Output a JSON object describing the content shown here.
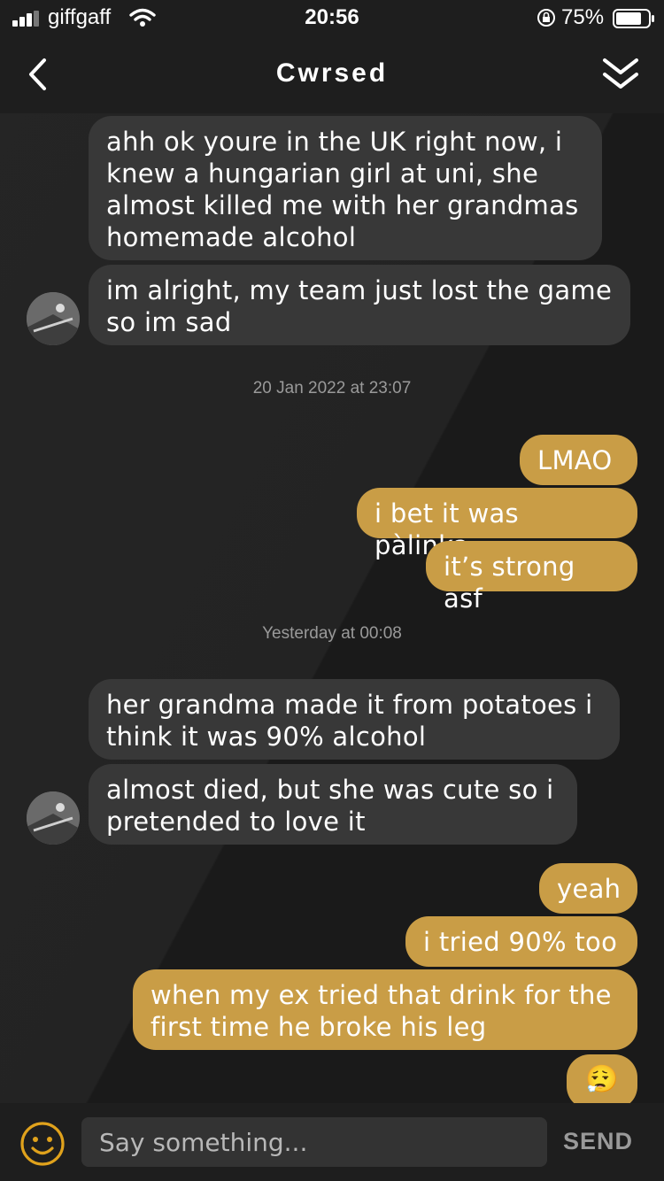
{
  "status_bar": {
    "carrier": "giffgaff",
    "time": "20:56",
    "battery": "75%"
  },
  "header": {
    "title": "Cwrsed",
    "back_icon": "chevron-left-icon",
    "collapse_icon": "double-chevron-down-icon"
  },
  "messages": [
    {
      "dir": "in",
      "text": "ahh ok youre in the UK right now, i knew a hungarian girl at uni, she almost killed me with her grandmas homemade alcohol"
    },
    {
      "dir": "in",
      "text": "im alright, my team just lost the game so im sad"
    },
    {
      "dir": "timestamp",
      "text": "20 Jan 2022 at 23:07"
    },
    {
      "dir": "out",
      "text": "LMAO"
    },
    {
      "dir": "out",
      "text": "i bet it was pàlinka"
    },
    {
      "dir": "out",
      "text": "it’s strong asf"
    },
    {
      "dir": "timestamp",
      "text": "Yesterday at 00:08"
    },
    {
      "dir": "in",
      "text": "her grandma made it from potatoes i think it was 90% alcohol"
    },
    {
      "dir": "in",
      "text": "almost died, but she was cute so i pretended to love it"
    },
    {
      "dir": "out",
      "text": "yeah"
    },
    {
      "dir": "out",
      "text": "i tried 90% too"
    },
    {
      "dir": "out",
      "text": "when my ex tried that drink for the first time he broke his leg"
    },
    {
      "dir": "out",
      "text": "😮‍💨"
    }
  ],
  "input": {
    "placeholder": "Say something...",
    "send_label": "SEND",
    "emoji_icon": "smiley-icon"
  },
  "colors": {
    "outgoing_bubble": "#c99d46",
    "incoming_bubble": "#383838",
    "background": "#1d1d1d",
    "accent_emoji_button": "#e0a21c"
  }
}
